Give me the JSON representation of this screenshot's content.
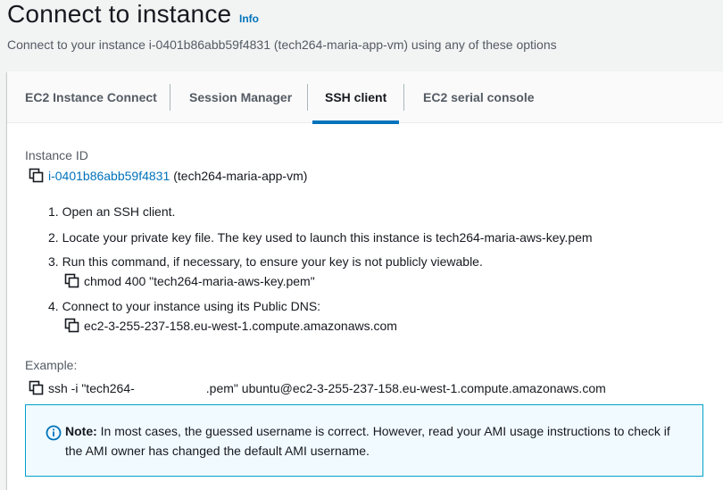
{
  "header": {
    "title": "Connect to instance",
    "info": "Info",
    "subtitle": "Connect to your instance i-0401b86abb59f4831 (tech264-maria-app-vm) using any of these options"
  },
  "tabs": [
    {
      "label": "EC2 Instance Connect",
      "active": false
    },
    {
      "label": "Session Manager",
      "active": false
    },
    {
      "label": "SSH client",
      "active": true
    },
    {
      "label": "EC2 serial console",
      "active": false
    }
  ],
  "instance": {
    "label": "Instance ID",
    "id": "i-0401b86abb59f4831",
    "name": "(tech264-maria-app-vm)"
  },
  "steps": {
    "step1": "1. Open an SSH client.",
    "step2": "2. Locate your private key file. The key used to launch this instance is tech264-maria-aws-key.pem",
    "step3": "3. Run this command, if necessary, to ensure your key is not publicly viewable.",
    "step3_command": "chmod 400 \"tech264-maria-aws-key.pem\"",
    "step4": "4. Connect to your instance using its Public DNS:",
    "step4_dns": "ec2-3-255-237-158.eu-west-1.compute.amazonaws.com"
  },
  "example": {
    "label": "Example:",
    "command_prefix": "ssh -i \"tech264-",
    "command_suffix": ".pem\" ubuntu@ec2-3-255-237-158.eu-west-1.compute.amazonaws.com"
  },
  "note": {
    "title": "Note:",
    "text": "In most cases, the guessed username is correct. However, read your AMI usage instructions to check if the AMI owner has changed the default AMI username."
  },
  "colors": {
    "link": "#0073bb",
    "tab_active_underline": "#0073bb",
    "note_border": "#00a1c9",
    "note_bg": "#f1faff"
  }
}
